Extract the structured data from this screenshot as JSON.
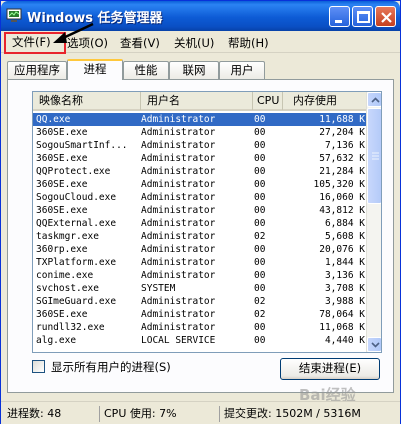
{
  "window": {
    "title": "Windows 任务管理器"
  },
  "menu": {
    "file": "文件(F)",
    "options": "选项(O)",
    "view": "查看(V)",
    "shutdown": "关机(U)",
    "help": "帮助(H)"
  },
  "tabs": [
    {
      "label": "应用程序"
    },
    {
      "label": "进程"
    },
    {
      "label": "性能"
    },
    {
      "label": "联网"
    },
    {
      "label": "用户"
    }
  ],
  "active_tab": "进程",
  "process_list": {
    "columns": [
      "映像名称",
      "用户名",
      "CPU",
      "内存使用"
    ],
    "rows": [
      [
        "QQ.exe",
        "Administrator",
        "00",
        "11,688 K"
      ],
      [
        "360SE.exe",
        "Administrator",
        "00",
        "27,204 K"
      ],
      [
        "SogouSmartInf...",
        "Administrator",
        "00",
        "7,136 K"
      ],
      [
        "360SE.exe",
        "Administrator",
        "00",
        "57,632 K"
      ],
      [
        "QQProtect.exe",
        "Administrator",
        "00",
        "21,284 K"
      ],
      [
        "360SE.exe",
        "Administrator",
        "00",
        "105,320 K"
      ],
      [
        "SogouCloud.exe",
        "Administrator",
        "00",
        "16,060 K"
      ],
      [
        "360SE.exe",
        "Administrator",
        "00",
        "43,812 K"
      ],
      [
        "QQExternal.exe",
        "Administrator",
        "00",
        "6,884 K"
      ],
      [
        "taskmgr.exe",
        "Administrator",
        "02",
        "5,608 K"
      ],
      [
        "360rp.exe",
        "Administrator",
        "00",
        "20,076 K"
      ],
      [
        "TXPlatform.exe",
        "Administrator",
        "00",
        "1,844 K"
      ],
      [
        "conime.exe",
        "Administrator",
        "00",
        "3,136 K"
      ],
      [
        "svchost.exe",
        "SYSTEM",
        "00",
        "3,708 K"
      ],
      [
        "SGImeGuard.exe",
        "Administrator",
        "02",
        "3,988 K"
      ],
      [
        "360SE.exe",
        "Administrator",
        "02",
        "78,064 K"
      ],
      [
        "rundll32.exe",
        "Administrator",
        "00",
        "11,068 K"
      ],
      [
        "alg.exe",
        "LOCAL SERVICE",
        "00",
        "4,440 K"
      ]
    ],
    "selected_row": 0
  },
  "controls": {
    "show_all_users": "显示所有用户的进程(S)",
    "end_process": "结束进程(E)"
  },
  "status": {
    "processes": "进程数: 48",
    "cpu": "CPU 使用: 7%",
    "commit": "提交更改: 1502M / 5316M"
  },
  "watermark": "Bai经验",
  "colors": {
    "selection": "#316ac5",
    "titlebar": "#0a5fd8",
    "annotation": "#e8242c"
  }
}
